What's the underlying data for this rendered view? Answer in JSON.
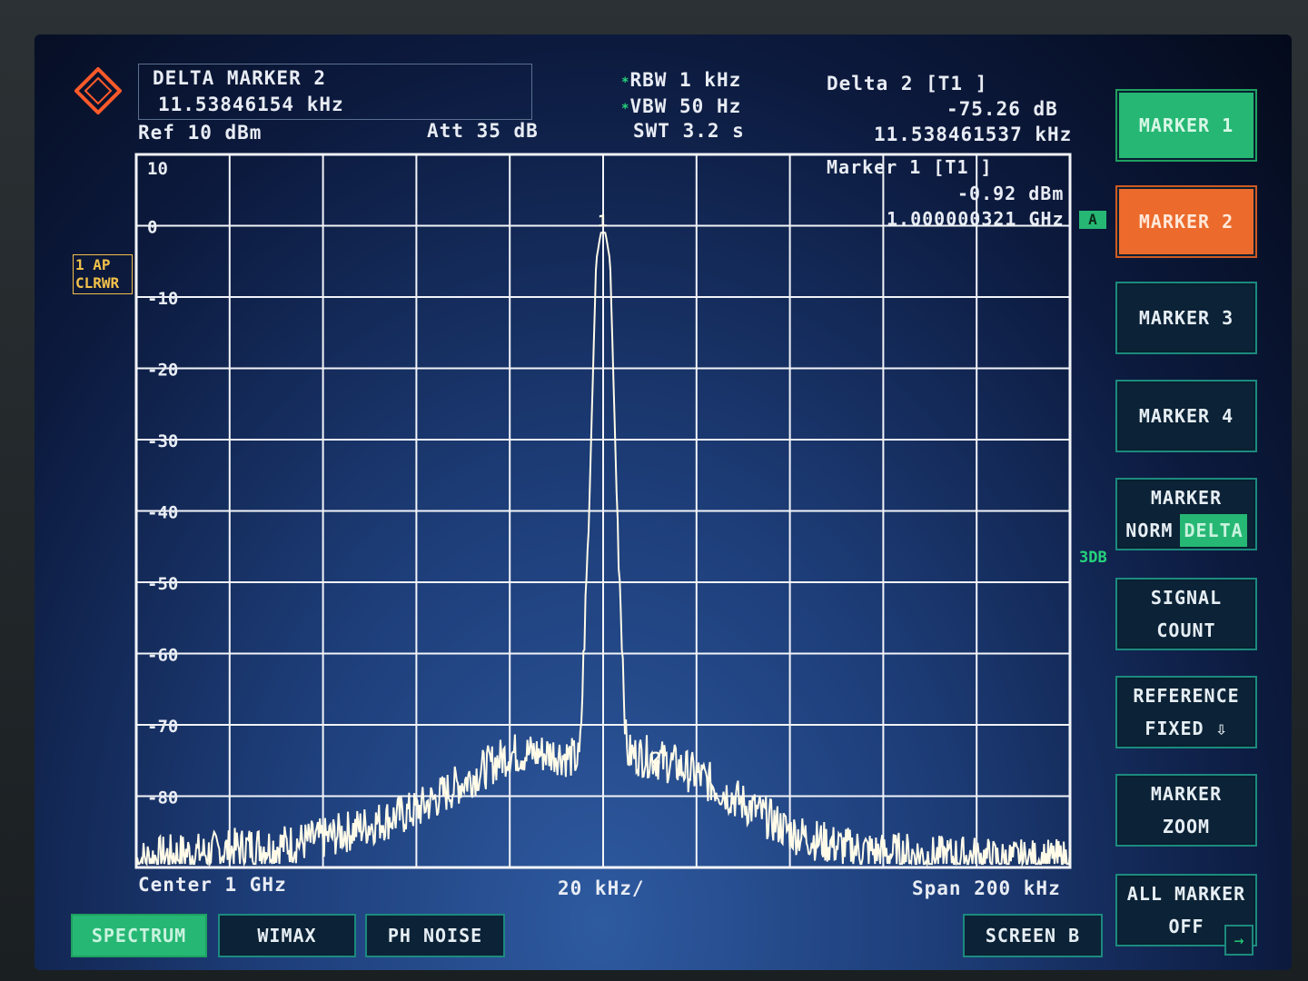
{
  "header": {
    "marker_title": "DELTA MARKER 2",
    "marker_value": "11.53846154 kHz",
    "ref": "Ref   10 dBm",
    "att": "Att   35 dB",
    "rbw": "RBW  1 kHz",
    "vbw": "VBW  50 Hz",
    "swt": "SWT  3.2 s",
    "delta_label": "Delta 2 [T1 ]",
    "delta_db": "-75.26 dB",
    "delta_freq": "11.538461537 kHz"
  },
  "plot_info": {
    "marker1_label": "Marker 1 [T1 ]",
    "marker1_level": "-0.92 dBm",
    "marker1_freq": "1.000000321 GHz",
    "trace_badge_line1": "1 AP",
    "trace_badge_line2": "CLRWR",
    "a_badge": "A",
    "threedb": "3DB",
    "marker1_num": "1",
    "marker2_num": "2"
  },
  "footer": {
    "center": "Center  1 GHz",
    "div": "20 kHz/",
    "span": "Span  200 kHz"
  },
  "softkeys": [
    {
      "line1": "MARKER 1",
      "line2": ""
    },
    {
      "line1": "MARKER 2",
      "line2": ""
    },
    {
      "line1": "MARKER 3",
      "line2": ""
    },
    {
      "line1": "MARKER 4",
      "line2": ""
    },
    {
      "line1": "MARKER",
      "norm": "NORM",
      "delta": "DELTA"
    },
    {
      "line1": "SIGNAL",
      "line2": "COUNT"
    },
    {
      "line1": "REFERENCE",
      "line2": "FIXED ⇩"
    },
    {
      "line1": "MARKER",
      "line2": "ZOOM"
    },
    {
      "line1": "ALL MARKER",
      "line2": "OFF"
    }
  ],
  "tabs": [
    "SPECTRUM",
    "WIMAX",
    "PH NOISE",
    "SCREEN B"
  ],
  "icons": {
    "logo": "rohde-schwarz-logo",
    "arrow": "→"
  },
  "colors": {
    "trace": "#fffbe8",
    "grid": "#f2f4f8",
    "accent_green": "#26b774",
    "accent_orange": "#ec6a2c"
  },
  "chart_data": {
    "type": "line",
    "xlabel": "",
    "ylabel": "",
    "x_range_khz": [
      -100,
      100
    ],
    "ylim": [
      -90,
      10
    ],
    "ytick_labels": [
      "10",
      "0",
      "-10",
      "-20",
      "-30",
      "-40",
      "-50",
      "-60",
      "-70",
      "-80"
    ],
    "ytick_values": [
      10,
      0,
      -10,
      -20,
      -30,
      -40,
      -50,
      -60,
      -70,
      -80
    ],
    "grid": true,
    "series": [
      {
        "x_khz": [
          -100,
          -95,
          -90,
          -85,
          -80,
          -75,
          -70,
          -65,
          -60,
          -55,
          -50,
          -45,
          -40,
          -35,
          -30,
          -25,
          -20,
          -15,
          -10,
          -5,
          -3,
          -1.5,
          -0.5,
          0,
          0.5,
          1.5,
          3,
          5,
          10,
          15,
          20,
          25,
          30,
          35,
          40,
          45,
          50,
          55,
          60,
          65,
          70,
          75,
          80,
          85,
          90,
          95,
          100
        ],
        "y_dbm": [
          -89,
          -88.5,
          -88,
          -88,
          -87.5,
          -87,
          -87,
          -86.5,
          -86,
          -85,
          -84,
          -83,
          -82,
          -80,
          -78,
          -76,
          -74,
          -74,
          -74,
          -75,
          -40,
          -5,
          -1,
          -0.92,
          -1,
          -5,
          -40,
          -74,
          -74.5,
          -75.5,
          -77,
          -79,
          -81,
          -83,
          -85,
          -86,
          -87,
          -87.5,
          -88,
          -88,
          -88.5,
          -88.5,
          -88.5,
          -89,
          -89,
          -89,
          -89
        ]
      }
    ],
    "markers": [
      {
        "name": "1",
        "x_khz": 0,
        "y_dbm": -0.92
      },
      {
        "name": "2",
        "x_khz": 11.538,
        "y_dbm": -76.18
      }
    ],
    "display_line_dbm": 0
  }
}
